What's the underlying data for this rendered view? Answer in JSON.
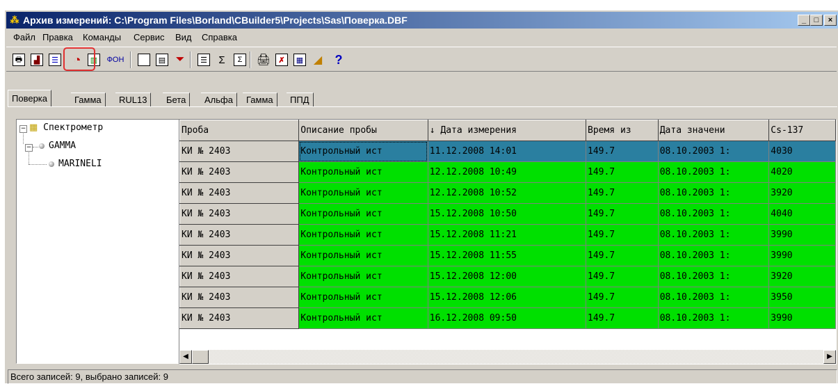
{
  "window": {
    "title": "Архив измерений: C:\\Program Files\\Borland\\CBuilder5\\Projects\\Sas\\Поверка.DBF"
  },
  "title_buttons": {
    "minimize": "_",
    "maximize": "□",
    "close": "×"
  },
  "menu": [
    {
      "label": "Файл"
    },
    {
      "label": "Правка"
    },
    {
      "label": "Команды"
    },
    {
      "label": "Сервис"
    },
    {
      "label": "Вид"
    },
    {
      "label": "Справка"
    }
  ],
  "toolbar": {
    "fon_label": "ФОН",
    "help_label": "?",
    "icons": [
      "print-preview-icon",
      "chart-icon",
      "tree-icon",
      "clock-icon",
      "spectrum-icon",
      "fon-icon",
      "new-doc-icon",
      "edit-icon",
      "filter-icon",
      "list-icon",
      "sum-icon",
      "sum-doc-icon",
      "print-icon",
      "delete-icon",
      "table-icon",
      "graph-icon",
      "help-icon"
    ]
  },
  "tabs": [
    {
      "label": "Поверка",
      "active": true
    },
    {
      "label": "Гамма"
    },
    {
      "label": "RUL13"
    },
    {
      "label": "Бета"
    },
    {
      "label": "Альфа"
    },
    {
      "label": "Гамма"
    },
    {
      "label": "ППД"
    }
  ],
  "tree": {
    "root": "Спектрометр",
    "child": "GAMMA",
    "leaf": "MARINELI"
  },
  "grid": {
    "columns": [
      "Проба",
      "Описание пробы",
      "↓ Дата измерения",
      "Время из",
      "Дата значени",
      "Cs-137"
    ],
    "rows": [
      [
        "КИ № 2403",
        "Контрольный ист",
        "11.12.2008 14:01",
        "149.7",
        "08.10.2003 1:",
        "4030"
      ],
      [
        "КИ № 2403",
        "Контрольный ист",
        "12.12.2008 10:49",
        "149.7",
        "08.10.2003 1:",
        "4020"
      ],
      [
        "КИ № 2403",
        "Контрольный ист",
        "12.12.2008 10:52",
        "149.7",
        "08.10.2003 1:",
        "3920"
      ],
      [
        "КИ № 2403",
        "Контрольный ист",
        "15.12.2008 10:50",
        "149.7",
        "08.10.2003 1:",
        "4040"
      ],
      [
        "КИ № 2403",
        "Контрольный ист",
        "15.12.2008 11:21",
        "149.7",
        "08.10.2003 1:",
        "3990"
      ],
      [
        "КИ № 2403",
        "Контрольный ист",
        "15.12.2008 11:55",
        "149.7",
        "08.10.2003 1:",
        "3990"
      ],
      [
        "КИ № 2403",
        "Контрольный ист",
        "15.12.2008 12:00",
        "149.7",
        "08.10.2003 1:",
        "3920"
      ],
      [
        "КИ № 2403",
        "Контрольный ист",
        "15.12.2008 12:06",
        "149.7",
        "08.10.2003 1:",
        "3950"
      ],
      [
        "КИ № 2403",
        "Контрольный ист",
        "16.12.2008 09:50",
        "149.7",
        "08.10.2003 1:",
        "3990"
      ]
    ],
    "row_color": "#00e000",
    "selected_color": "#2a7fa0"
  },
  "scroll": {
    "left": "◀",
    "right": "▶"
  },
  "status": "Всего записей: 9, выбрано записей: 9"
}
